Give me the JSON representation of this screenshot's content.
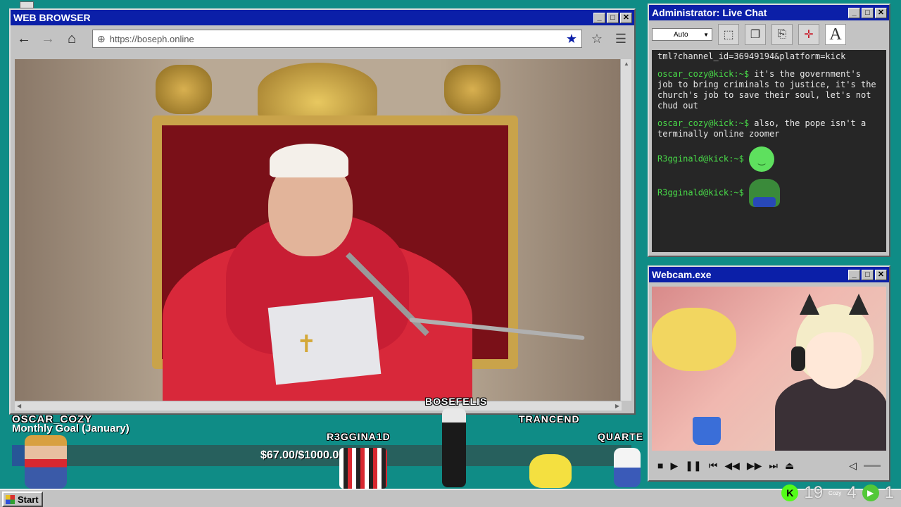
{
  "browser": {
    "title": "WEB BROWSER",
    "url": "https://boseph.online",
    "controls": {
      "min": "▁",
      "max": "□",
      "close": "✕"
    }
  },
  "chat": {
    "title": "Administrator: Live Chat",
    "select_value": "Auto",
    "messages": [
      {
        "user": "",
        "text": "tml?channel_id=36949194&platform=kick"
      },
      {
        "user": "oscar_cozy@kick:~$",
        "text": " it's the government's job to bring criminals to justice, it's the church's job to save their soul, let's not chud out"
      },
      {
        "user": "oscar_cozy@kick:~$",
        "text": " also, the pope isn't a terminally online zoomer"
      },
      {
        "user": "R3gginald@kick:~$",
        "text": ""
      },
      {
        "user": "R3gginald@kick:~$",
        "text": ""
      }
    ]
  },
  "webcam": {
    "title": "Webcam.exe"
  },
  "goal": {
    "username": "OSCAR_COZY",
    "title": "Monthly Goal (January)",
    "amount": "$67.00/$1000.00",
    "progress": 0.067
  },
  "viewers": [
    {
      "name": "R3GGINA1D"
    },
    {
      "name": "BOSEFELIS"
    },
    {
      "name": "TRANCEND"
    },
    {
      "name": "QUARTE"
    }
  ],
  "taskbar": {
    "start_label": "Start",
    "kick_count": "19",
    "cozy_label": "Cozy",
    "cozy_count": "4",
    "play_count": "1"
  }
}
